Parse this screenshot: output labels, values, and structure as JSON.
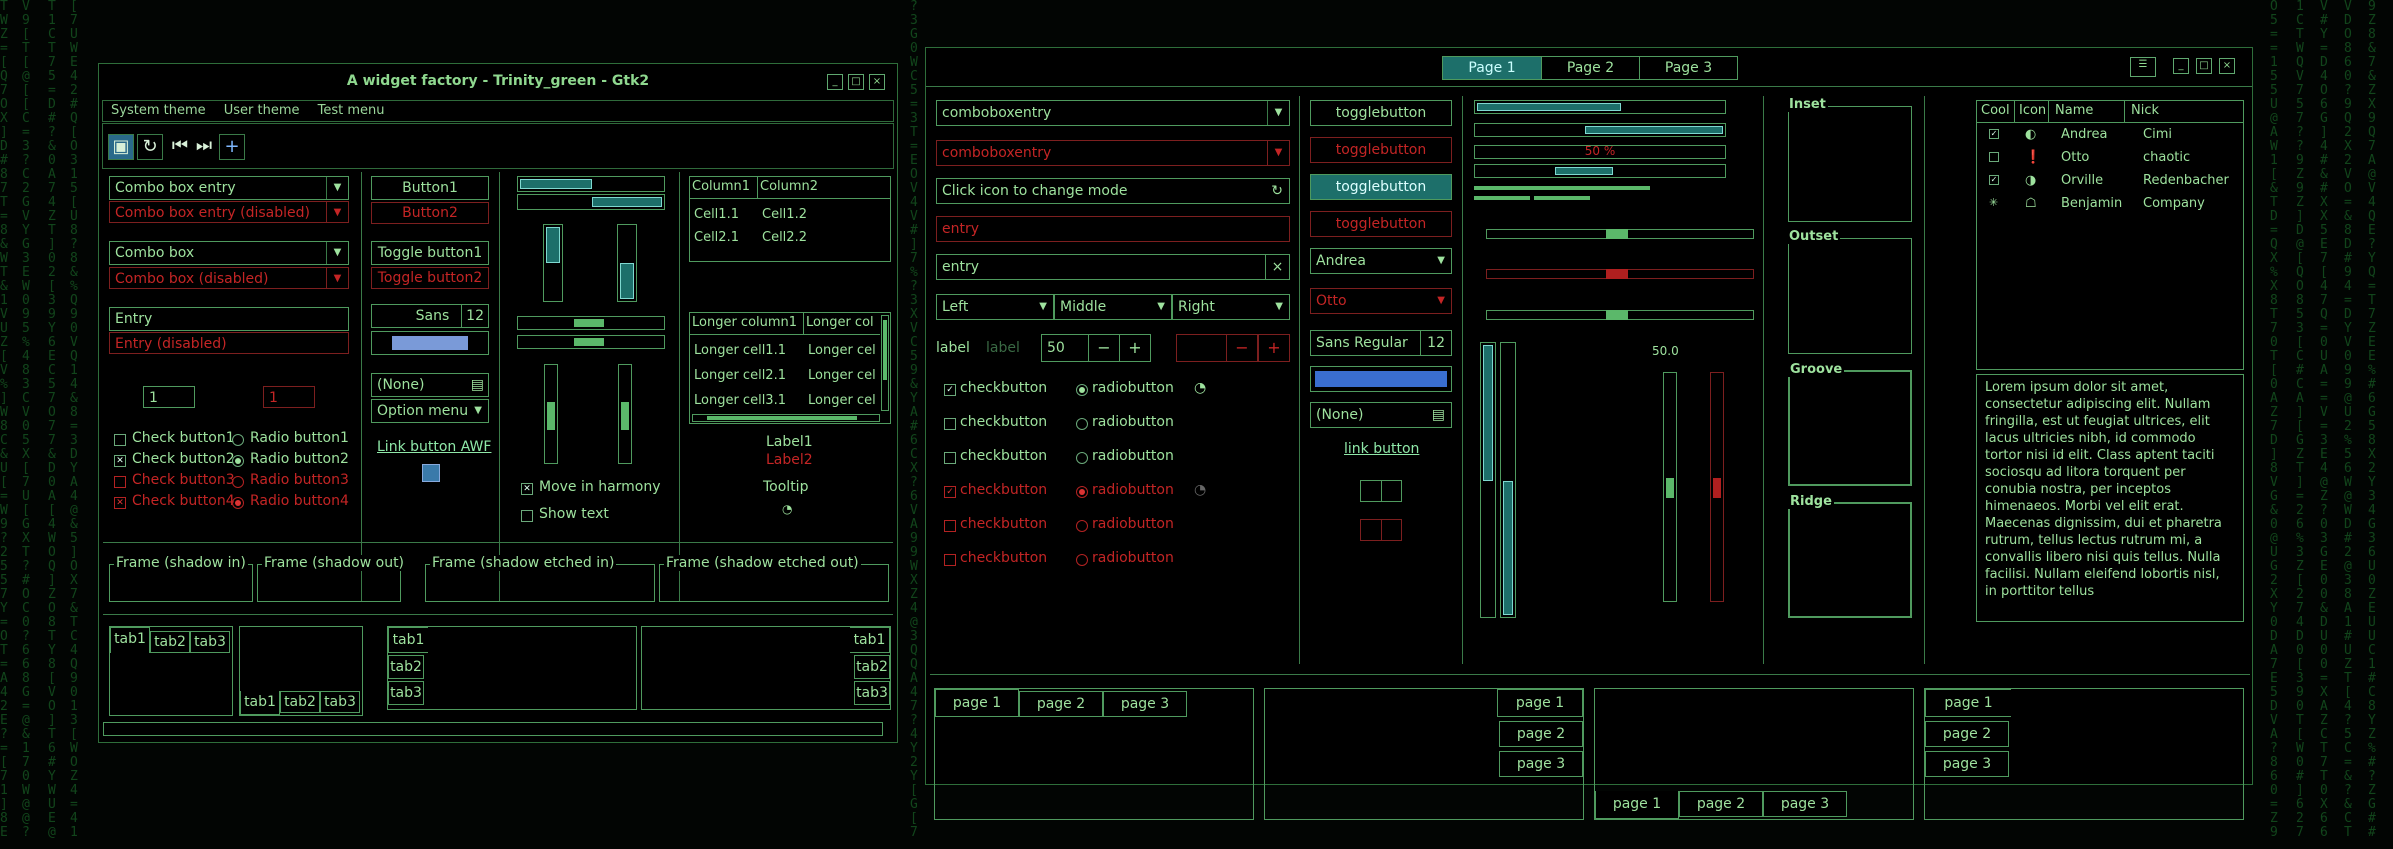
{
  "left_window": {
    "title": "A widget factory - Trinity_green - Gtk2",
    "menu": [
      "System theme",
      "User theme",
      "Test menu"
    ],
    "combo_entry": "Combo box entry",
    "combo_entry_disabled": "Combo box entry (disabled)",
    "combo_box": "Combo box",
    "combo_box_disabled": "Combo box (disabled)",
    "entry": "Entry",
    "entry_disabled": "Entry (disabled)",
    "spin_value": "1",
    "spin_value_disabled": "1",
    "check1": "Check button1",
    "check2": "Check button2",
    "check3": "Check button3",
    "check4": "Check button4",
    "radio1": "Radio button1",
    "radio2": "Radio button2",
    "radio3": "Radio button3",
    "radio4": "Radio button4",
    "button1": "Button1",
    "button2": "Button2",
    "toggle1": "Toggle button1",
    "toggle2": "Toggle button2",
    "font_name": "Sans",
    "font_size": "12",
    "none_file": "(None)",
    "option_menu": "Option menu",
    "link_button": "Link button AWF",
    "move_harmony": "Move in harmony",
    "show_text": "Show text",
    "table_small": {
      "headers": [
        "Column1",
        "Column2"
      ],
      "rows": [
        [
          "Cell1.1",
          "Cell1.2"
        ],
        [
          "Cell2.1",
          "Cell2.2"
        ]
      ]
    },
    "table_long": {
      "headers": [
        "Longer column1",
        "Longer col"
      ],
      "rows": [
        [
          "Longer cell1.1",
          "Longer cel"
        ],
        [
          "Longer cell2.1",
          "Longer cel"
        ],
        [
          "Longer cell3.1",
          "Longer cel"
        ]
      ]
    },
    "label1": "Label1",
    "label2": "Label2",
    "tooltip": "Tooltip",
    "frames": [
      "Frame (shadow in)",
      "Frame (shadow out)",
      "Frame (shadow etched in)",
      "Frame (shadow etched out)"
    ],
    "tabs": [
      "tab1",
      "tab2",
      "tab3"
    ],
    "accent": "#1d6f6a",
    "disabled_color": "#c42525"
  },
  "right_window": {
    "header_tabs": [
      "Page 1",
      "Page 2",
      "Page 3"
    ],
    "comboboxentry": "comboboxentry",
    "comboboxentry_disabled": "comboboxentry",
    "icon_entry_placeholder": "Click icon to change mode",
    "entry_disabled": "entry",
    "entry": "entry",
    "align": [
      "Left",
      "Middle",
      "Right"
    ],
    "label": "label",
    "label_disabled": "label",
    "spin_value": "50",
    "checkbutton": "checkbutton",
    "radiobutton": "radiobutton",
    "togglebutton": "togglebutton",
    "combo_andrea": "Andrea",
    "combo_otto": "Otto",
    "font": "Sans Regular",
    "font_size": "12",
    "none_file": "(None)",
    "link_button": "link button",
    "progress_text": "50 %",
    "scale_value": "50.0",
    "frames": [
      "Inset",
      "Outset",
      "Groove",
      "Ridge"
    ],
    "tree_headers": [
      "Cool",
      "Icon",
      "Name",
      "Nick"
    ],
    "tree_rows": [
      {
        "name": "Andrea",
        "nick": "Cimi"
      },
      {
        "name": "Otto",
        "nick": "chaotic"
      },
      {
        "name": "Orville",
        "nick": "Redenbacher"
      },
      {
        "name": "Benjamin",
        "nick": "Company"
      }
    ],
    "lorem": "Lorem ipsum dolor sit amet, consectetur adipiscing elit. Nullam fringilla, est ut feugiat ultrices, elit lacus ultricies nibh, id commodo tortor nisi id elit. Class aptent taciti sociosqu ad litora torquent per conubia nostra, per inceptos himenaeos. Morbi vel elit erat. Maecenas dignissim, dui et pharetra rutrum, tellus lectus rutrum mi, a convallis libero nisi quis tellus. Nulla facilisi. Nullam eleifend lobortis nisl, in porttitor tellus",
    "notebook_tabs": [
      "page 1",
      "page 2",
      "page 3"
    ]
  },
  "matrix_glyphs": "0 1 7 Z ? & % = C D 9 5 4 ] [ T Q W X A E 8 6 3 2 # @ G O Y V U"
}
